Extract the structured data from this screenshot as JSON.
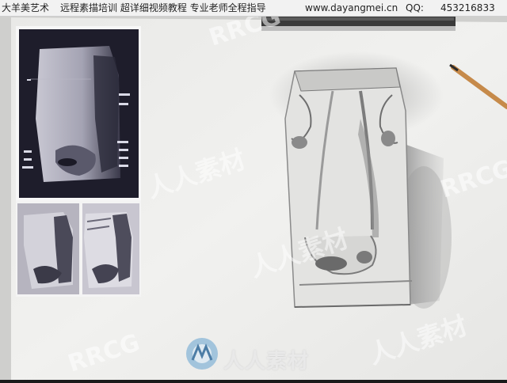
{
  "banner": {
    "brand": "大羊美艺术",
    "course": "远程素描培训 超详细视频教程 专业老师全程指导",
    "website": "www.dayangmei.cn",
    "qq_label": "QQ:",
    "qq_number": "453216833"
  },
  "watermarks": {
    "rrcg": "RRCG",
    "site_name": "人人素材"
  },
  "colors": {
    "paper": "#eeeeec",
    "board": "#d8d8d6",
    "reference_bg": "#1d1c2a",
    "graphite": "#6d6d6d"
  }
}
